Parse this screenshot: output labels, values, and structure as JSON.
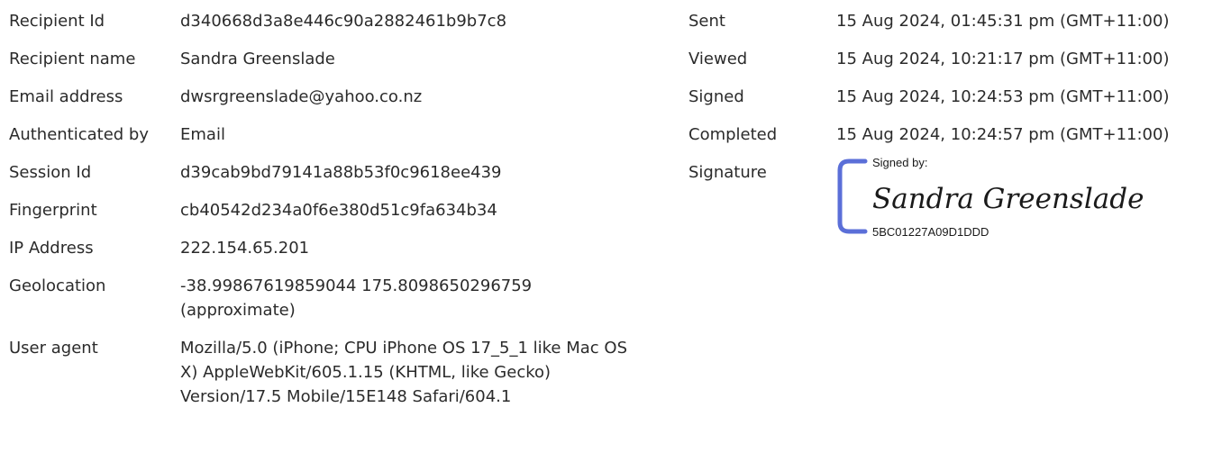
{
  "recipient": {
    "id_label": "Recipient Id",
    "id_value": "d340668d3a8e446c90a2882461b9b7c8",
    "name_label": "Recipient name",
    "name_value": "Sandra Greenslade",
    "email_label": "Email address",
    "email_value": "dwsrgreenslade@yahoo.co.nz",
    "auth_label": "Authenticated by",
    "auth_value": "Email",
    "session_label": "Session Id",
    "session_value": "d39cab9bd79141a88b53f0c9618ee439",
    "fingerprint_label": "Fingerprint",
    "fingerprint_value": "cb40542d234a0f6e380d51c9fa634b34",
    "ip_label": "IP Address",
    "ip_value": "222.154.65.201",
    "geo_label": "Geolocation",
    "geo_value": "-38.99867619859044 175.8098650296759 (approximate)",
    "ua_label": "User agent",
    "ua_value": "Mozilla/5.0 (iPhone; CPU iPhone OS 17_5_1 like Mac OS X) AppleWebKit/605.1.15 (KHTML, like Gecko) Version/17.5 Mobile/15E148 Safari/604.1"
  },
  "events": {
    "sent_label": "Sent",
    "sent_value": "15 Aug 2024, 01:45:31 pm (GMT+11:00)",
    "viewed_label": "Viewed",
    "viewed_value": "15 Aug 2024, 10:21:17 pm (GMT+11:00)",
    "signed_label": "Signed",
    "signed_value": "15 Aug 2024, 10:24:53 pm (GMT+11:00)",
    "completed_label": "Completed",
    "completed_value": "15 Aug 2024, 10:24:57 pm (GMT+11:00)",
    "signature_label": "Signature"
  },
  "signature": {
    "signed_by": "Signed by:",
    "name": "Sandra Greenslade",
    "code": "5BC01227A09D1DDD",
    "bracket_color": "#5b6fd8"
  }
}
